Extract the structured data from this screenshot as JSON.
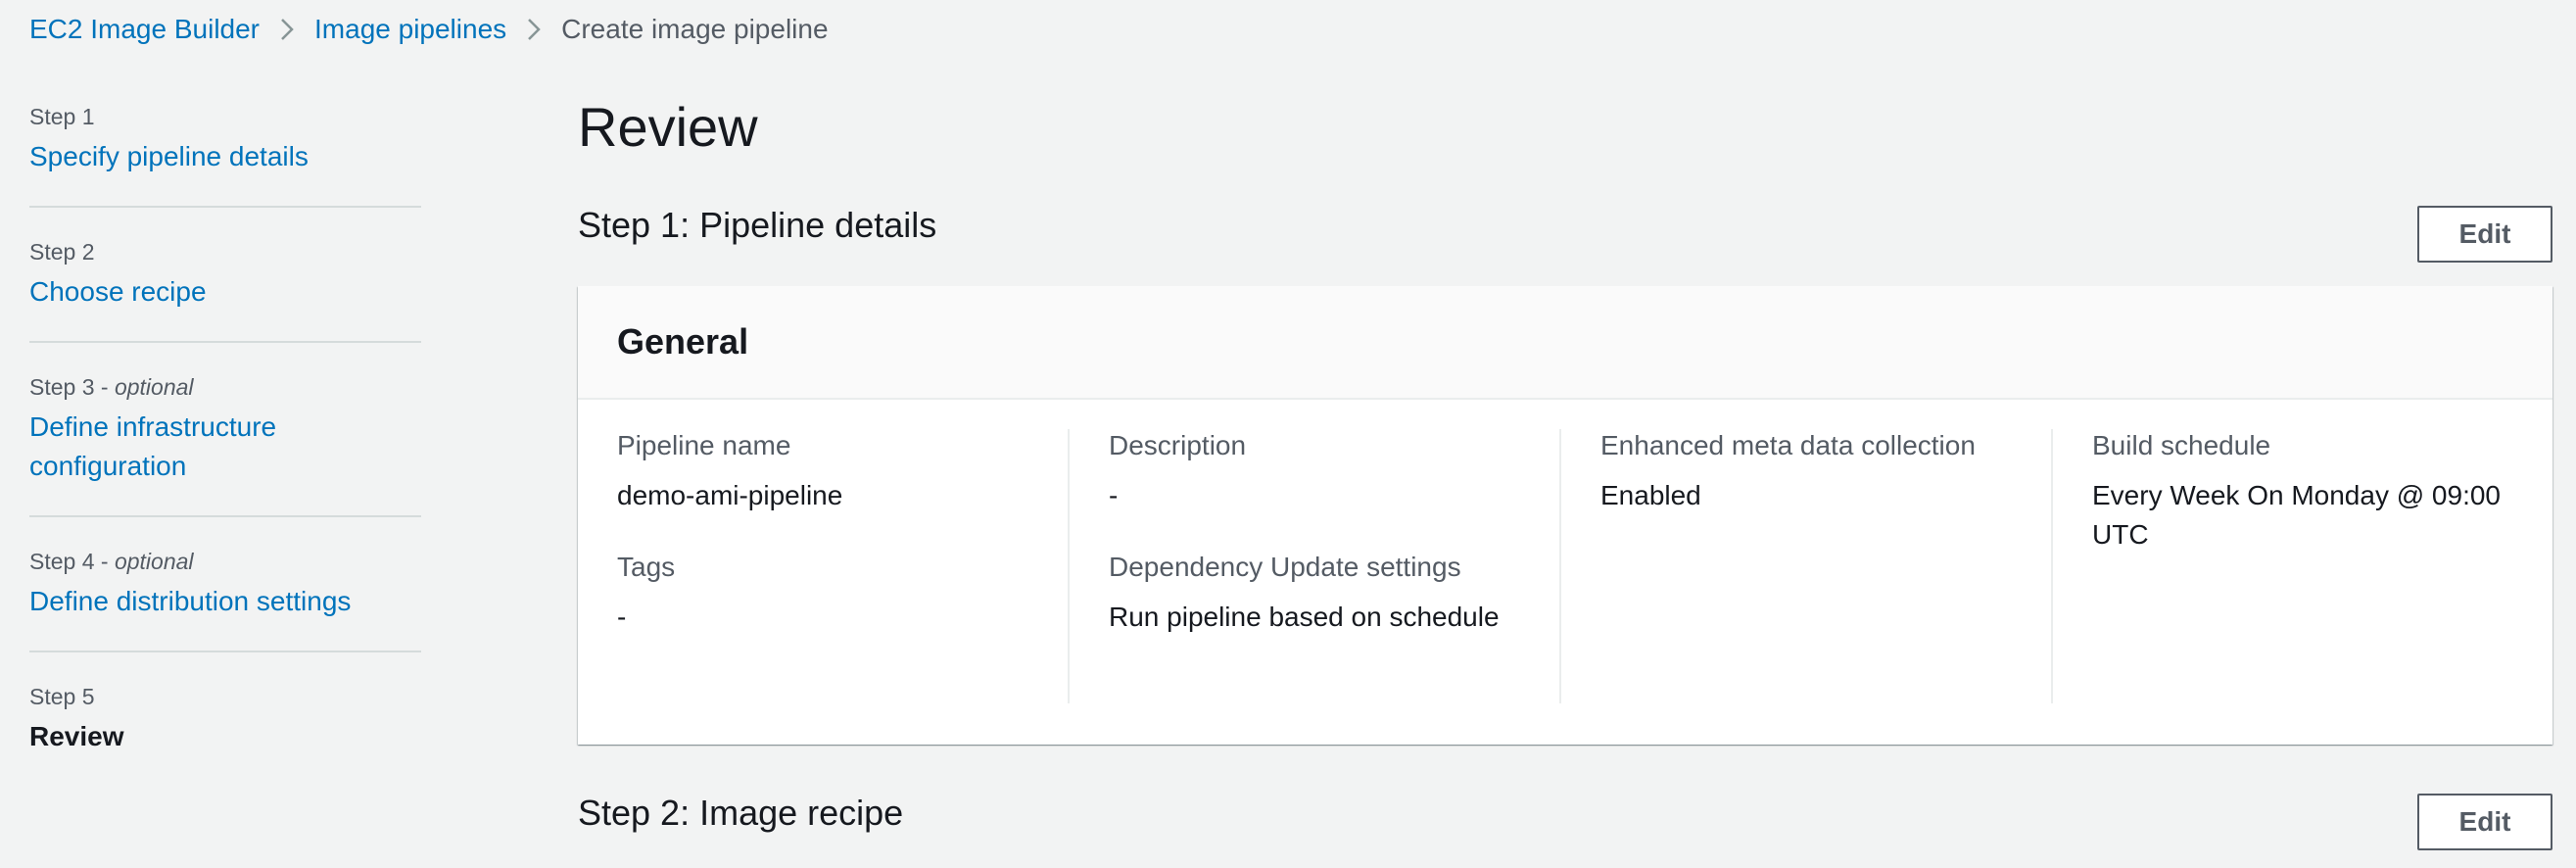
{
  "breadcrumb": {
    "items": [
      "EC2 Image Builder",
      "Image pipelines"
    ],
    "current": "Create image pipeline"
  },
  "steps": [
    {
      "number": "Step 1",
      "optional": "",
      "title": "Specify pipeline details"
    },
    {
      "number": "Step 2",
      "optional": "",
      "title": "Choose recipe"
    },
    {
      "number": "Step 3",
      "optional": "optional",
      "title": "Define infrastructure configuration"
    },
    {
      "number": "Step 4",
      "optional": "optional",
      "title": "Define distribution settings"
    },
    {
      "number": "Step 5",
      "optional": "",
      "title": "Review"
    }
  ],
  "main": {
    "title": "Review",
    "section1": {
      "title": "Step 1: Pipeline details",
      "edit_label": "Edit",
      "card_title": "General",
      "fields": {
        "pipeline_name_label": "Pipeline name",
        "pipeline_name_value": "demo-ami-pipeline",
        "tags_label": "Tags",
        "tags_value": "-",
        "description_label": "Description",
        "description_value": "-",
        "dependency_label": "Dependency Update settings",
        "dependency_value": "Run pipeline based on schedule",
        "enhanced_label": "Enhanced meta data collection",
        "enhanced_value": "Enabled",
        "schedule_label": "Build schedule",
        "schedule_value": "Every Week On Monday @ 09:00 UTC"
      }
    },
    "section2": {
      "title": "Step 2: Image recipe",
      "edit_label": "Edit"
    }
  },
  "colors": {
    "link": "#0073bb",
    "background": "#f2f3f3",
    "text": "#16191f",
    "secondary_text": "#545b64"
  }
}
